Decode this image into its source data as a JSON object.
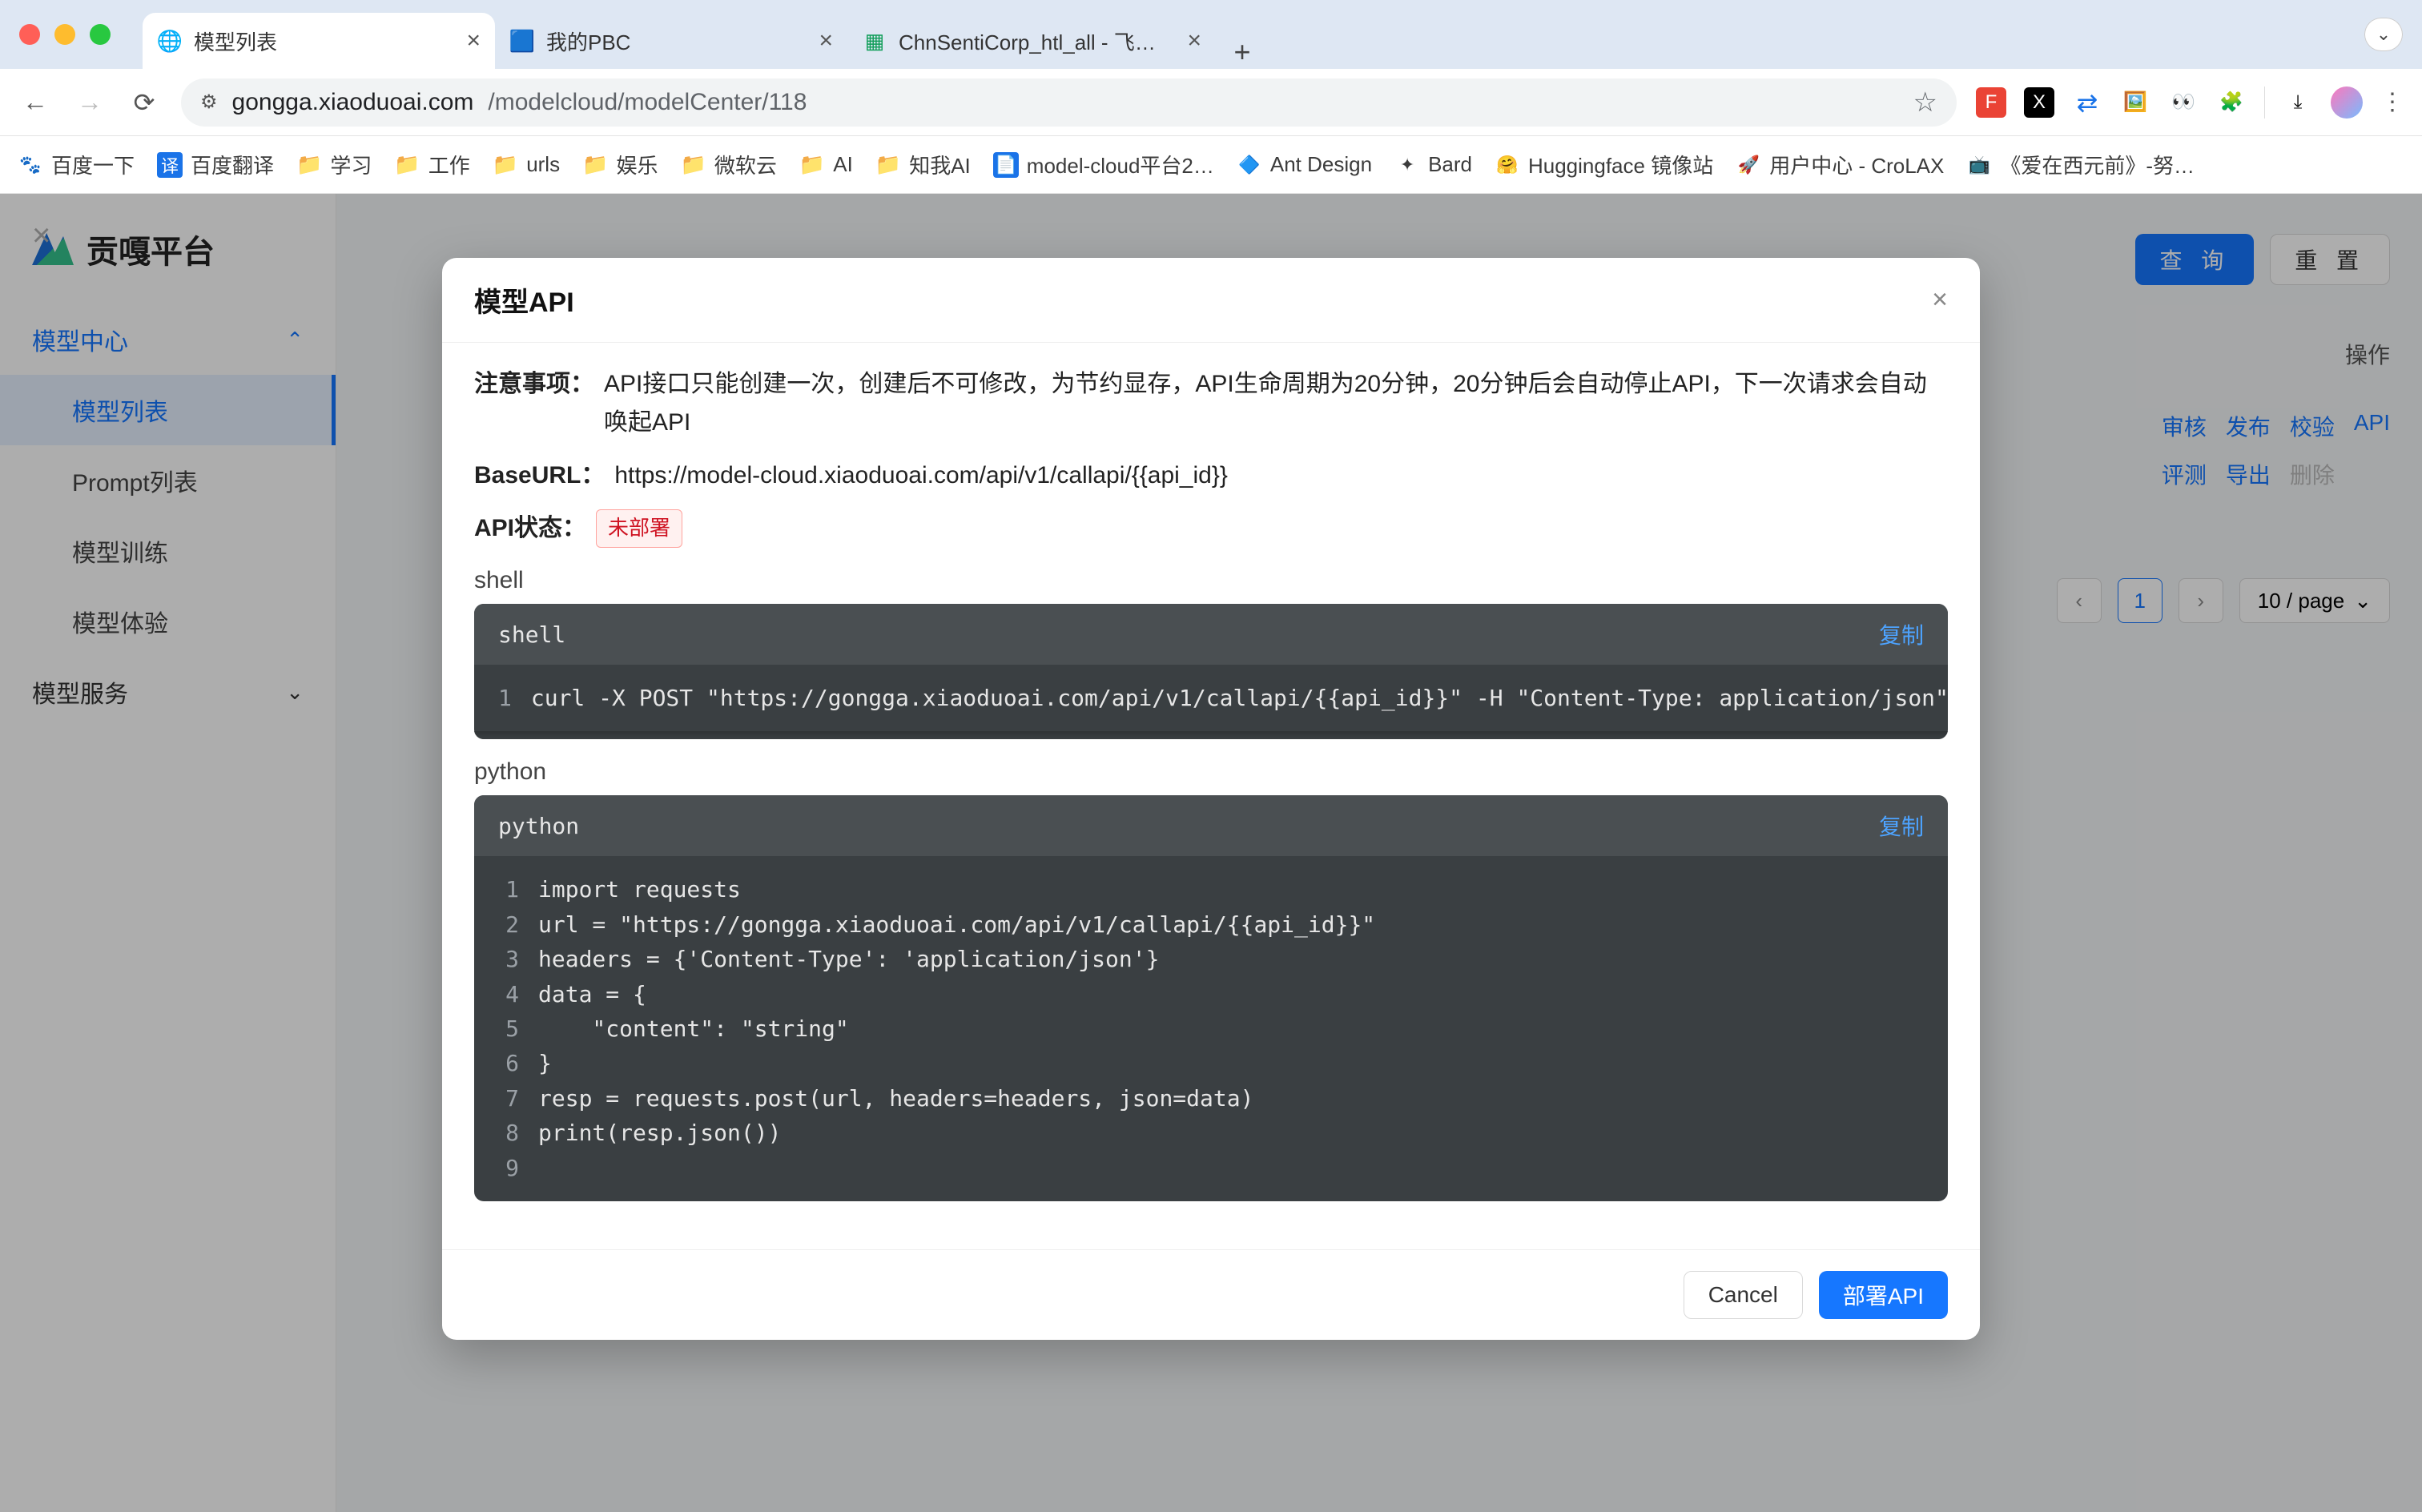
{
  "browser": {
    "tabs": [
      {
        "title": "模型列表",
        "active": true
      },
      {
        "title": "我的PBC",
        "active": false
      },
      {
        "title": "ChnSentiCorp_htl_all - 飞书云",
        "active": false
      }
    ],
    "url_host": "gongga.xiaoduoai.com",
    "url_path": "/modelcloud/modelCenter/118",
    "bookmarks": [
      "百度一下",
      "百度翻译",
      "学习",
      "工作",
      "urls",
      "娱乐",
      "微软云",
      "AI",
      "知我AI",
      "model-cloud平台2…",
      "Ant Design",
      "Bard",
      "Huggingface 镜像站",
      "用户中心 - CroLAX",
      "《爱在西元前》-努…"
    ]
  },
  "sidebar": {
    "brand": "贡嘎平台",
    "group1": {
      "title": "模型中心",
      "items": [
        "模型列表",
        "Prompt列表",
        "模型训练",
        "模型体验"
      ],
      "active_index": 0
    },
    "group2": {
      "title": "模型服务"
    }
  },
  "main": {
    "query_btn": "查 询",
    "reset_btn": "重 置",
    "col_action": "操作",
    "row_actions_1": [
      "审核",
      "发布",
      "校验",
      "API"
    ],
    "row_actions_2": [
      "评测",
      "导出",
      "删除"
    ],
    "page_current": "1",
    "page_size": "10 / page"
  },
  "modal": {
    "title": "模型API",
    "notice_label": "注意事项：",
    "notice_text": "API接口只能创建一次，创建后不可修改，为节约显存，API生命周期为20分钟，20分钟后会自动停止API，下一次请求会自动唤起API",
    "baseurl_label": "BaseURL：",
    "baseurl_value": "https://model-cloud.xiaoduoai.com/api/v1/callapi/{{api_id}}",
    "status_label": "API状态：",
    "status_tag": "未部署",
    "shell_label": "shell",
    "python_label": "python",
    "copy_label": "复制",
    "shell_lang": "shell",
    "shell_code": [
      "curl -X POST \"https://gongga.xiaoduoai.com/api/v1/callapi/{{api_id}}\" -H \"Content-Type: application/json\" -d"
    ],
    "python_lang": "python",
    "python_code": [
      "import requests",
      "url = \"https://gongga.xiaoduoai.com/api/v1/callapi/{{api_id}}\"",
      "headers = {'Content-Type': 'application/json'}",
      "data = {",
      "    \"content\": \"string\"",
      "}",
      "resp = requests.post(url, headers=headers, json=data)",
      "print(resp.json())",
      ""
    ],
    "cancel": "Cancel",
    "deploy": "部署API"
  }
}
